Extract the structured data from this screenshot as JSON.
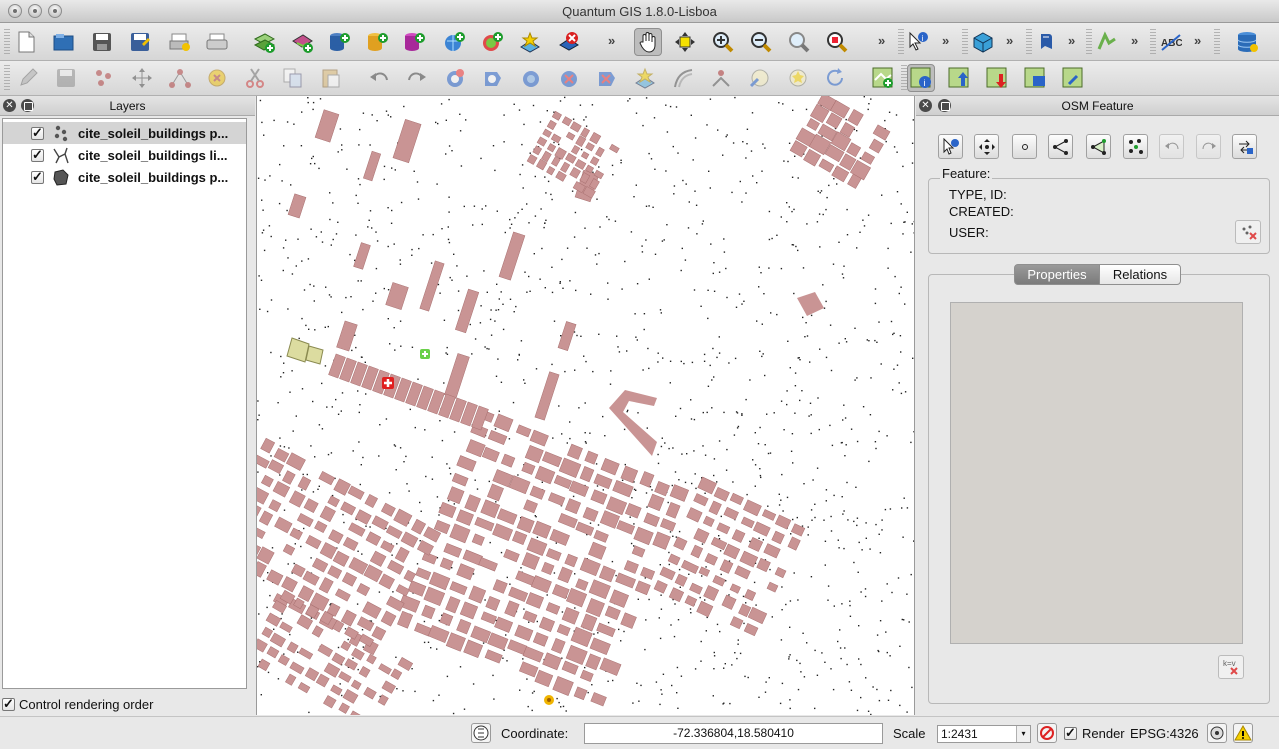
{
  "window": {
    "title": "Quantum GIS 1.8.0-Lisboa"
  },
  "toolbar_main": {
    "icons": [
      "new-project",
      "open-project",
      "save-project",
      "save-project-as",
      "new-print-composer",
      "print",
      "add-vector-layer",
      "add-raster-layer",
      "add-postgis-layer",
      "add-spatialite-layer",
      "add-wms-layer",
      "add-wfs-layer",
      "add-delimited-text-layer",
      "remove-layer",
      "pan",
      "pan-to-selection",
      "zoom-in",
      "zoom-out",
      "zoom-full",
      "zoom-selection",
      "identify",
      "gps-tool",
      "osm-load",
      "label-tool",
      "database"
    ],
    "overflow": "»"
  },
  "toolbar_edit": {
    "icons": [
      "toggle-editing",
      "save-edits",
      "capture-point",
      "move-feature",
      "node-tool",
      "delete-selected",
      "cut-features",
      "copy-features",
      "paste-features",
      "undo",
      "redo",
      "add-ring",
      "add-part",
      "fill-ring",
      "delete-ring",
      "delete-part",
      "reshape",
      "offset-curve",
      "split-features",
      "merge-attributes",
      "merge-features",
      "rotate-point",
      "osm-add-layer",
      "osm-identify",
      "osm-upload",
      "osm-download",
      "osm-import"
    ]
  },
  "layers_dock": {
    "title": "Layers",
    "items": [
      {
        "label": "cite_soleil_buildings p...",
        "type": "points",
        "checked": true,
        "selected": true
      },
      {
        "label": "cite_soleil_buildings li...",
        "type": "lines",
        "checked": true,
        "selected": false
      },
      {
        "label": "cite_soleil_buildings p...",
        "type": "polygons",
        "checked": true,
        "selected": false
      }
    ],
    "control_rendering_order": "Control rendering order"
  },
  "osm_dock": {
    "title": "OSM Feature",
    "feature_label": "Feature:",
    "fields": [
      "TYPE, ID:",
      "CREATED:",
      "USER:"
    ],
    "tabs": [
      "Properties",
      "Relations"
    ],
    "active_tab": "Properties"
  },
  "statusbar": {
    "coordinate_label": "Coordinate:",
    "coordinate_value": "-72.336804,18.580410",
    "scale_label": "Scale",
    "scale_value": "1:2431",
    "render_label": "Render",
    "render_checked": true,
    "crs": "EPSG:4326"
  },
  "colors": {
    "building_fill": "#c99494",
    "building_selected": "#dcdca0",
    "window_bg": "#e8e8e8"
  }
}
